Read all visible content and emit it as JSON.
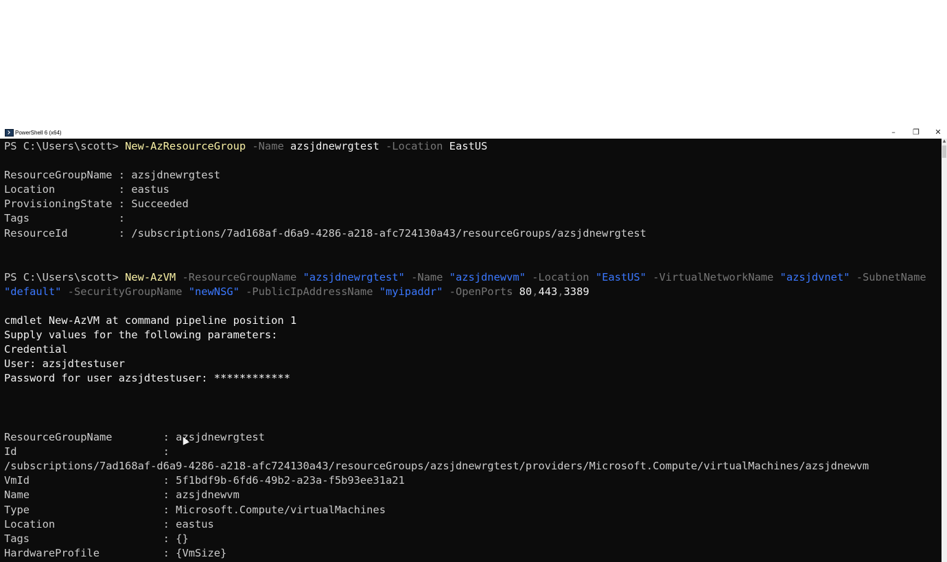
{
  "window": {
    "title": "PowerShell 6 (x64)",
    "minimize": "–",
    "maximize": "❐",
    "close": "✕"
  },
  "console": {
    "cmd1": {
      "prompt": "PS C:\\Users\\scott> ",
      "cmdlet": "New-AzResourceGroup",
      "p_name": " -Name ",
      "v_name": "azsjdnewrgtest",
      "p_location": " -Location ",
      "v_location": "EastUS"
    },
    "out1": [
      "ResourceGroupName : azsjdnewrgtest",
      "Location          : eastus",
      "ProvisioningState : Succeeded",
      "Tags              :",
      "ResourceId        : /subscriptions/7ad168af-d6a9-4286-a218-afc724130a43/resourceGroups/azsjdnewrgtest"
    ],
    "cmd2": {
      "prompt": "PS C:\\Users\\scott> ",
      "cmdlet": "New-AzVM",
      "p1": " -ResourceGroupName ",
      "v1": "\"azsjdnewrgtest\"",
      "p2": " -Name ",
      "v2": "\"azsjdnewvm\"",
      "p3": " -Location ",
      "v3": "\"EastUS\"",
      "p4": " -VirtualNetworkName ",
      "v4": "\"azsjdvnet\"",
      "p5": " -SubnetName",
      "v5": "\"default\"",
      "p6": " -SecurityGroupName ",
      "v6": "\"newNSG\"",
      "p7": " -PublicIpAddressName ",
      "v7": "\"myipaddr\"",
      "p8": " -OpenPorts ",
      "v8a": "80",
      "sep1": ",",
      "v8b": "443",
      "sep2": ",",
      "v8c": "3389"
    },
    "prompt_lines": [
      "cmdlet New-AzVM at command pipeline position 1",
      "Supply values for the following parameters:",
      "Credential",
      "User: azsjdtestuser",
      "Password for user azsjdtestuser: ************"
    ],
    "out2": [
      "ResourceGroupName        : azsjdnewrgtest",
      "Id                       :",
      "/subscriptions/7ad168af-d6a9-4286-a218-afc724130a43/resourceGroups/azsjdnewrgtest/providers/Microsoft.Compute/virtualMachines/azsjdnewvm",
      "VmId                     : 5f1bdf9b-6fd6-49b2-a23a-f5b93ee31a21",
      "Name                     : azsjdnewvm",
      "Type                     : Microsoft.Compute/virtualMachines",
      "Location                 : eastus",
      "Tags                     : {}",
      "HardwareProfile          : {VmSize}"
    ]
  }
}
